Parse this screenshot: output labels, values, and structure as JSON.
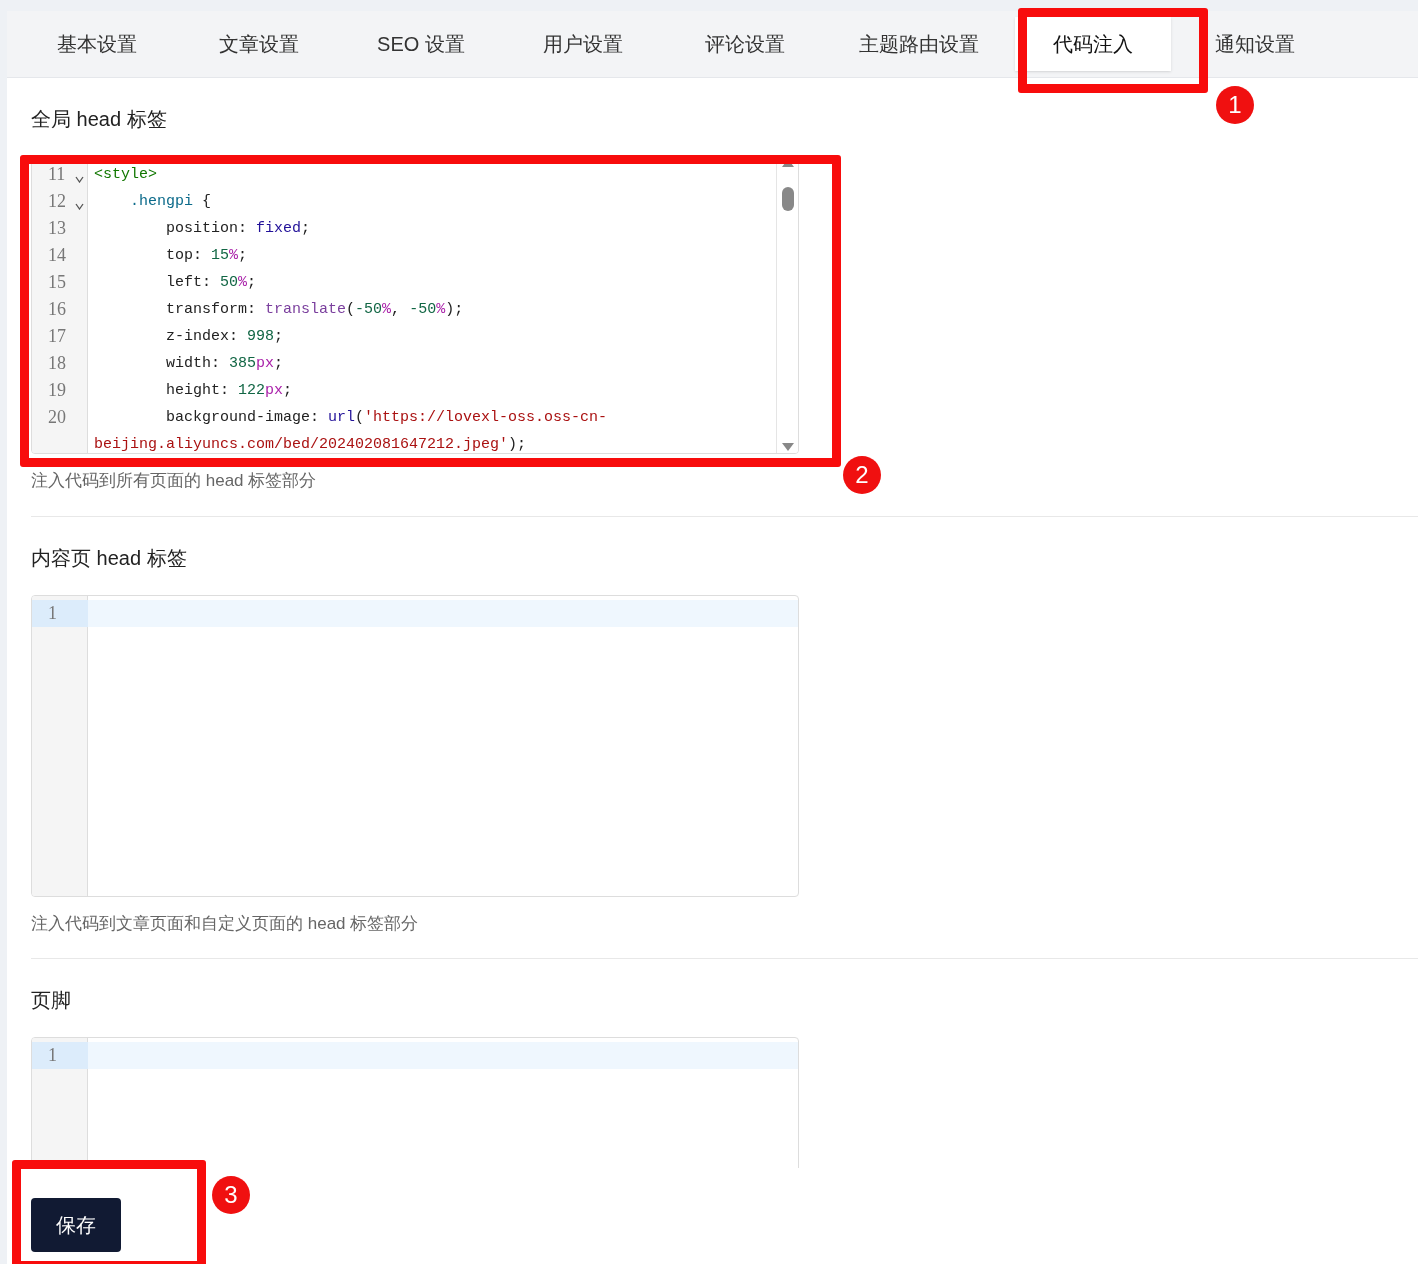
{
  "tabs": [
    {
      "label": "基本设置",
      "selected": false
    },
    {
      "label": "文章设置",
      "selected": false
    },
    {
      "label": "SEO 设置",
      "selected": false
    },
    {
      "label": "用户设置",
      "selected": false
    },
    {
      "label": "评论设置",
      "selected": false
    },
    {
      "label": "主题路由设置",
      "selected": false
    },
    {
      "label": "代码注入",
      "selected": true
    },
    {
      "label": "通知设置",
      "selected": false
    }
  ],
  "sections": [
    {
      "title": "全局 head 标签",
      "help": "注入代码到所有页面的 head 标签部分",
      "scrollbar": true,
      "lines": [
        {
          "number": "11",
          "fold": true,
          "active": false,
          "tokens": [
            {
              "text": "<style>",
              "kind": "tag"
            }
          ]
        },
        {
          "number": "12",
          "fold": true,
          "active": false,
          "tokens": [
            {
              "text": "    .hengpi",
              "kind": "class"
            },
            {
              "text": " {",
              "kind": "plain"
            }
          ]
        },
        {
          "number": "13",
          "fold": false,
          "active": false,
          "tokens": [
            {
              "text": "        position: ",
              "kind": "plain"
            },
            {
              "text": "fixed",
              "kind": "keyword"
            },
            {
              "text": ";",
              "kind": "plain"
            }
          ]
        },
        {
          "number": "14",
          "fold": false,
          "active": false,
          "tokens": [
            {
              "text": "        top: ",
              "kind": "plain"
            },
            {
              "text": "15",
              "kind": "number"
            },
            {
              "text": "%",
              "kind": "unit"
            },
            {
              "text": ";",
              "kind": "plain"
            }
          ]
        },
        {
          "number": "15",
          "fold": false,
          "active": false,
          "tokens": [
            {
              "text": "        left: ",
              "kind": "plain"
            },
            {
              "text": "50",
              "kind": "number"
            },
            {
              "text": "%",
              "kind": "unit"
            },
            {
              "text": ";",
              "kind": "plain"
            }
          ]
        },
        {
          "number": "16",
          "fold": false,
          "active": false,
          "tokens": [
            {
              "text": "        transform: ",
              "kind": "plain"
            },
            {
              "text": "translate",
              "kind": "function"
            },
            {
              "text": "(",
              "kind": "plain"
            },
            {
              "text": "-50",
              "kind": "number"
            },
            {
              "text": "%",
              "kind": "unit"
            },
            {
              "text": ", ",
              "kind": "plain"
            },
            {
              "text": "-50",
              "kind": "number"
            },
            {
              "text": "%",
              "kind": "unit"
            },
            {
              "text": ");",
              "kind": "plain"
            }
          ]
        },
        {
          "number": "17",
          "fold": false,
          "active": false,
          "tokens": [
            {
              "text": "        z-index: ",
              "kind": "plain"
            },
            {
              "text": "998",
              "kind": "number"
            },
            {
              "text": ";",
              "kind": "plain"
            }
          ]
        },
        {
          "number": "18",
          "fold": false,
          "active": false,
          "tokens": [
            {
              "text": "        width: ",
              "kind": "plain"
            },
            {
              "text": "385",
              "kind": "number"
            },
            {
              "text": "px",
              "kind": "unit"
            },
            {
              "text": ";",
              "kind": "plain"
            }
          ]
        },
        {
          "number": "19",
          "fold": false,
          "active": false,
          "tokens": [
            {
              "text": "        height: ",
              "kind": "plain"
            },
            {
              "text": "122",
              "kind": "number"
            },
            {
              "text": "px",
              "kind": "unit"
            },
            {
              "text": ";",
              "kind": "plain"
            }
          ]
        },
        {
          "number": "20",
          "fold": false,
          "active": false,
          "tokens": [
            {
              "text": "        background-image: ",
              "kind": "plain"
            },
            {
              "text": "url",
              "kind": "keyword"
            },
            {
              "text": "(",
              "kind": "plain"
            },
            {
              "text": "'https://lovexl-oss.oss-cn-beijing.aliyuncs.com/bed/202402081647212.jpeg'",
              "kind": "string"
            },
            {
              "text": ");",
              "kind": "plain"
            }
          ]
        }
      ]
    },
    {
      "title": "内容页 head 标签",
      "help": "注入代码到文章页面和自定义页面的 head 标签部分",
      "scrollbar": false,
      "lines": [
        {
          "number": "1",
          "fold": false,
          "active": true
        }
      ]
    },
    {
      "title": "页脚",
      "scrollbar": false,
      "lines": [
        {
          "number": "1",
          "fold": false,
          "active": true
        }
      ]
    }
  ],
  "save_button": "保存",
  "annotations": [
    "1",
    "2",
    "3"
  ]
}
